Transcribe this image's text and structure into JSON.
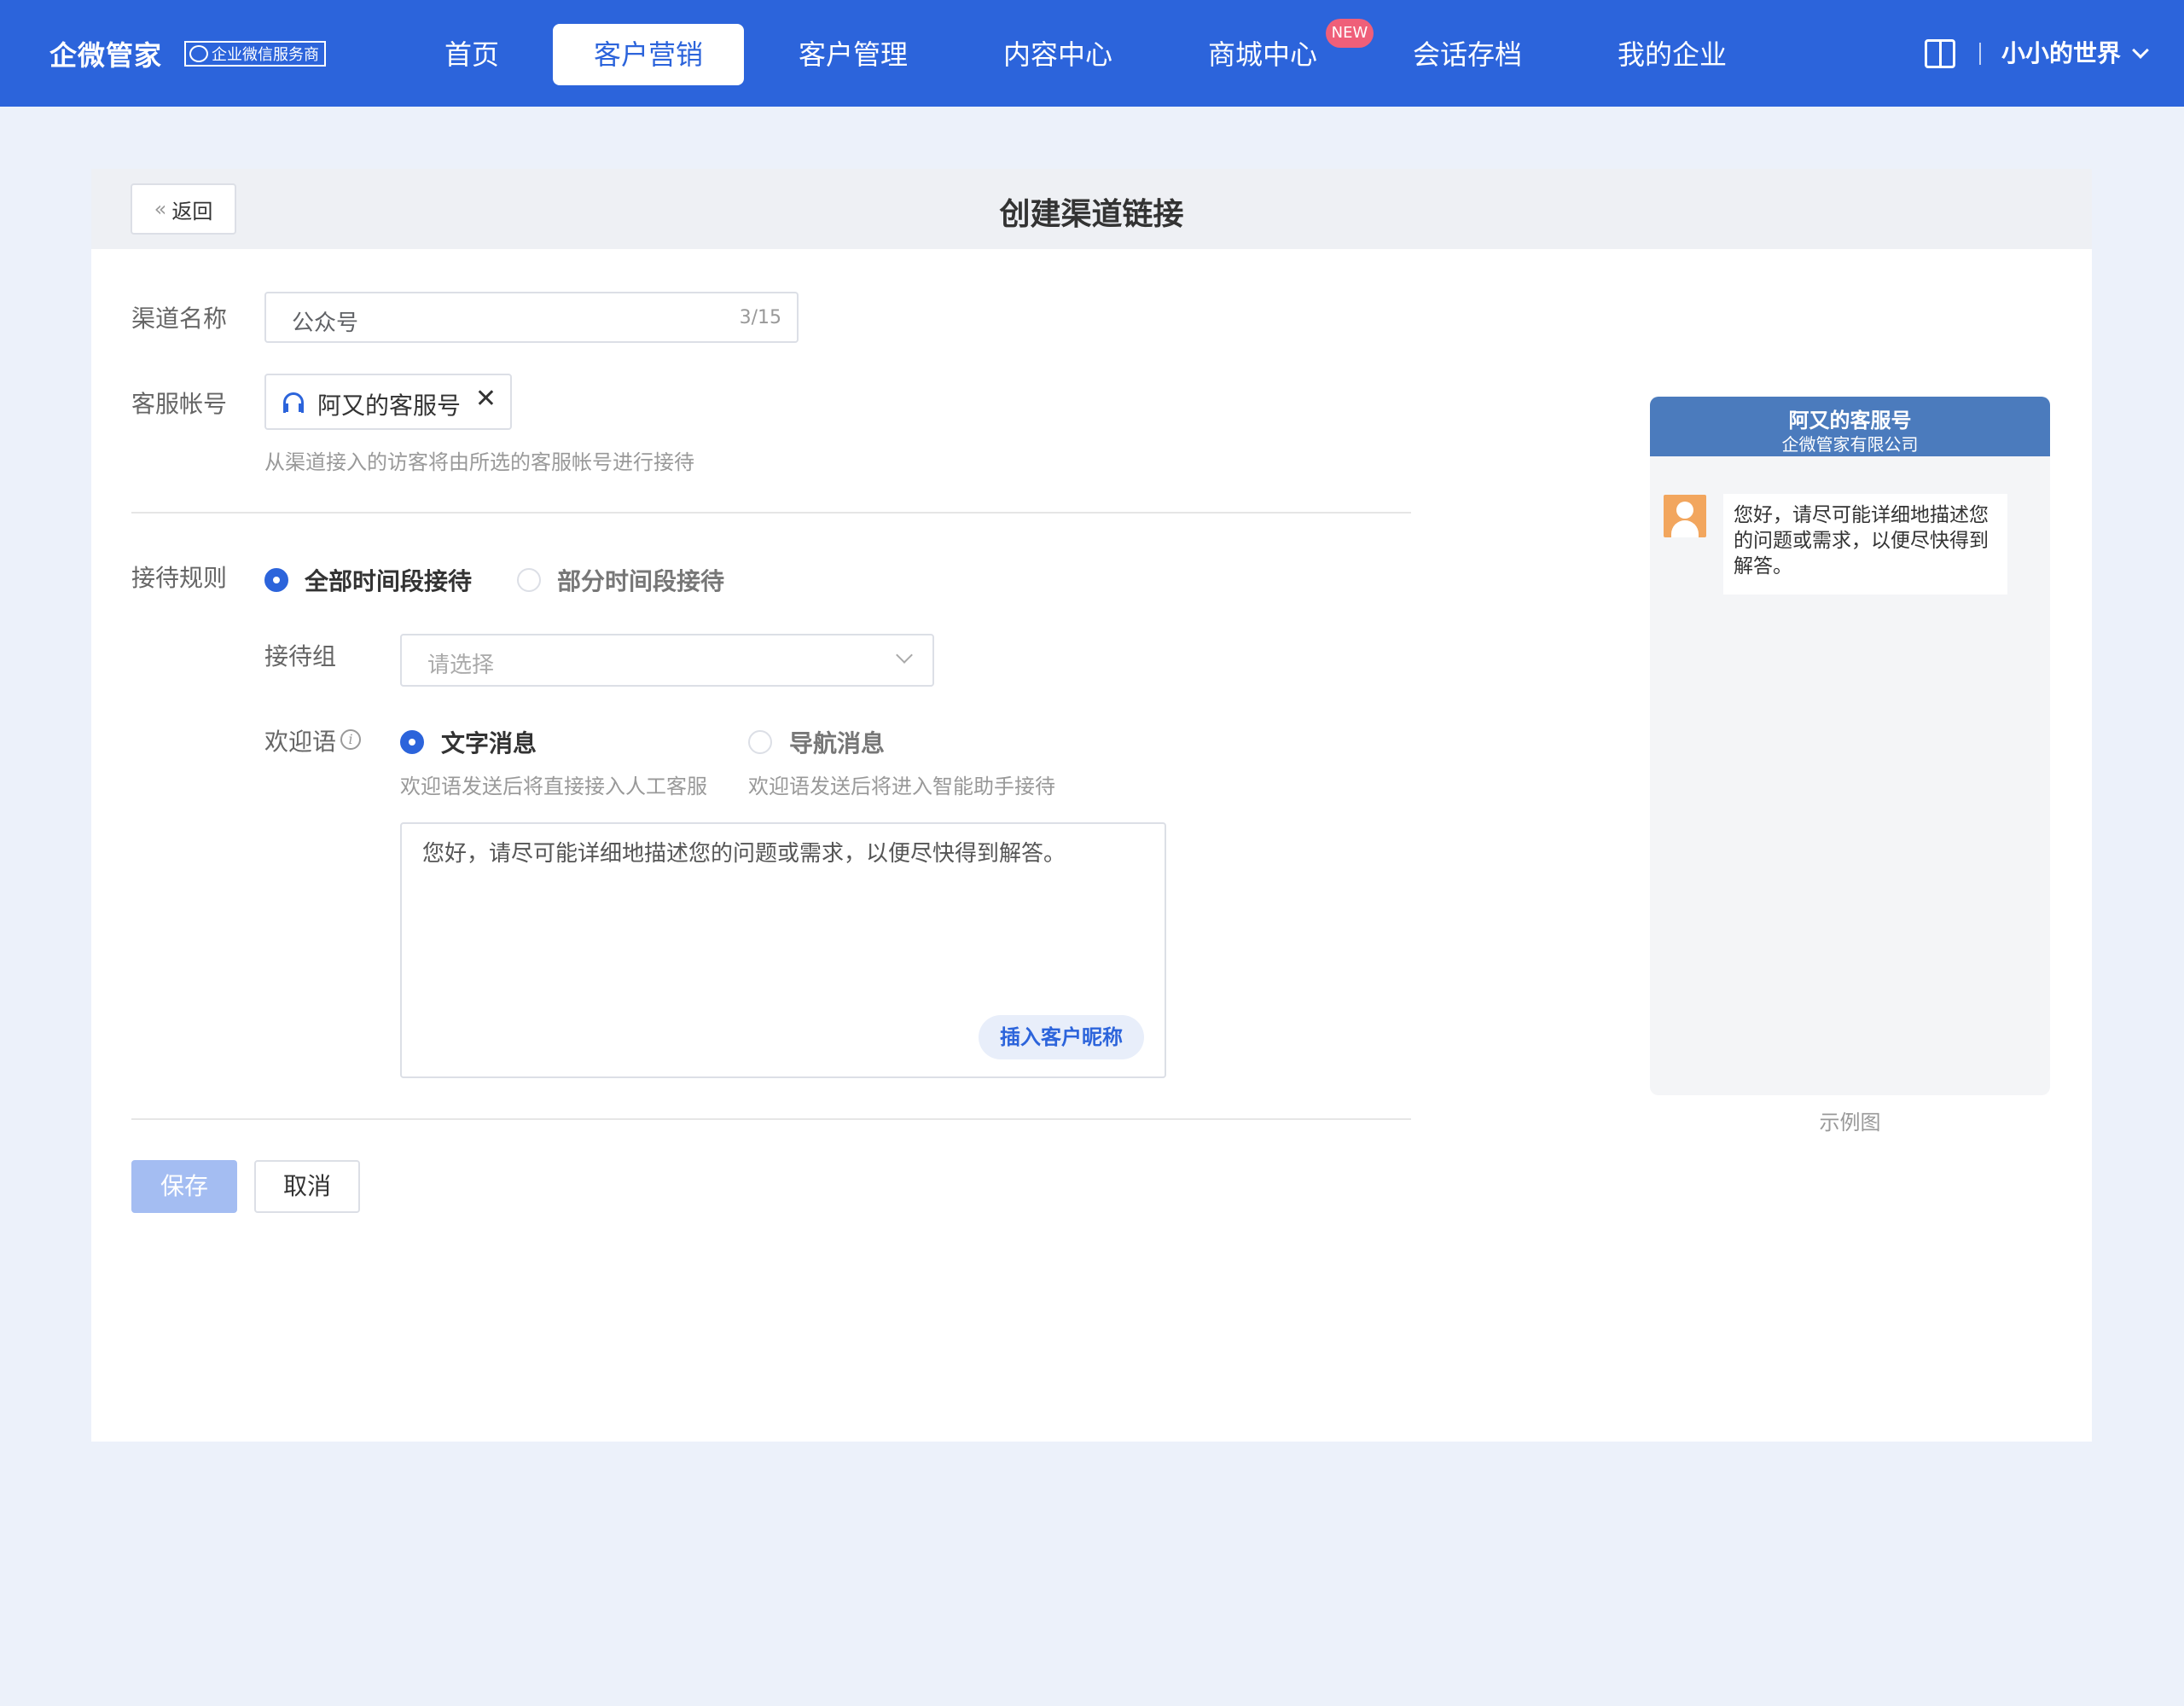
{
  "brand": {
    "name": "企微管家",
    "badge": "企业微信服务商"
  },
  "nav": {
    "items": [
      {
        "label": "首页"
      },
      {
        "label": "客户营销"
      },
      {
        "label": "客户管理"
      },
      {
        "label": "内容中心"
      },
      {
        "label": "商城中心"
      },
      {
        "label": "会话存档"
      },
      {
        "label": "我的企业"
      }
    ],
    "active_index": 1,
    "new_badge": "NEW"
  },
  "user": {
    "name": "小小的世界"
  },
  "page": {
    "back_label": "返回",
    "title": "创建渠道链接"
  },
  "form": {
    "channel_name": {
      "label": "渠道名称",
      "value": "公众号",
      "counter": "3/15"
    },
    "service_account": {
      "label": "客服帐号",
      "tag": "阿又的客服号",
      "hint": "从渠道接入的访客将由所选的客服帐号进行接待"
    },
    "reception_rule": {
      "label": "接待规则",
      "options": [
        "全部时间段接待",
        "部分时间段接待"
      ],
      "selected": 0
    },
    "reception_group": {
      "label": "接待组",
      "placeholder": "请选择"
    },
    "welcome": {
      "label": "欢迎语",
      "options": [
        {
          "label": "文字消息",
          "desc": "欢迎语发送后将直接接入人工客服"
        },
        {
          "label": "导航消息",
          "desc": "欢迎语发送后将进入智能助手接待"
        }
      ],
      "selected": 0,
      "text": "您好，请尽可能详细地描述您的问题或需求，以便尽快得到解答。",
      "insert_label": "插入客户昵称"
    }
  },
  "buttons": {
    "save": "保存",
    "cancel": "取消"
  },
  "preview": {
    "name": "阿又的客服号",
    "company": "企微管家有限公司",
    "message_lines": [
      "您好，请尽可能详细地描述您",
      "的问题或需求，以便尽快得到",
      "解答。"
    ],
    "sample_label": "示例图"
  },
  "colors": {
    "primary": "#2c64db",
    "page_bg": "#ecf1fa",
    "preview_header": "#4b7bbd",
    "new_badge": "#ef5f79"
  }
}
